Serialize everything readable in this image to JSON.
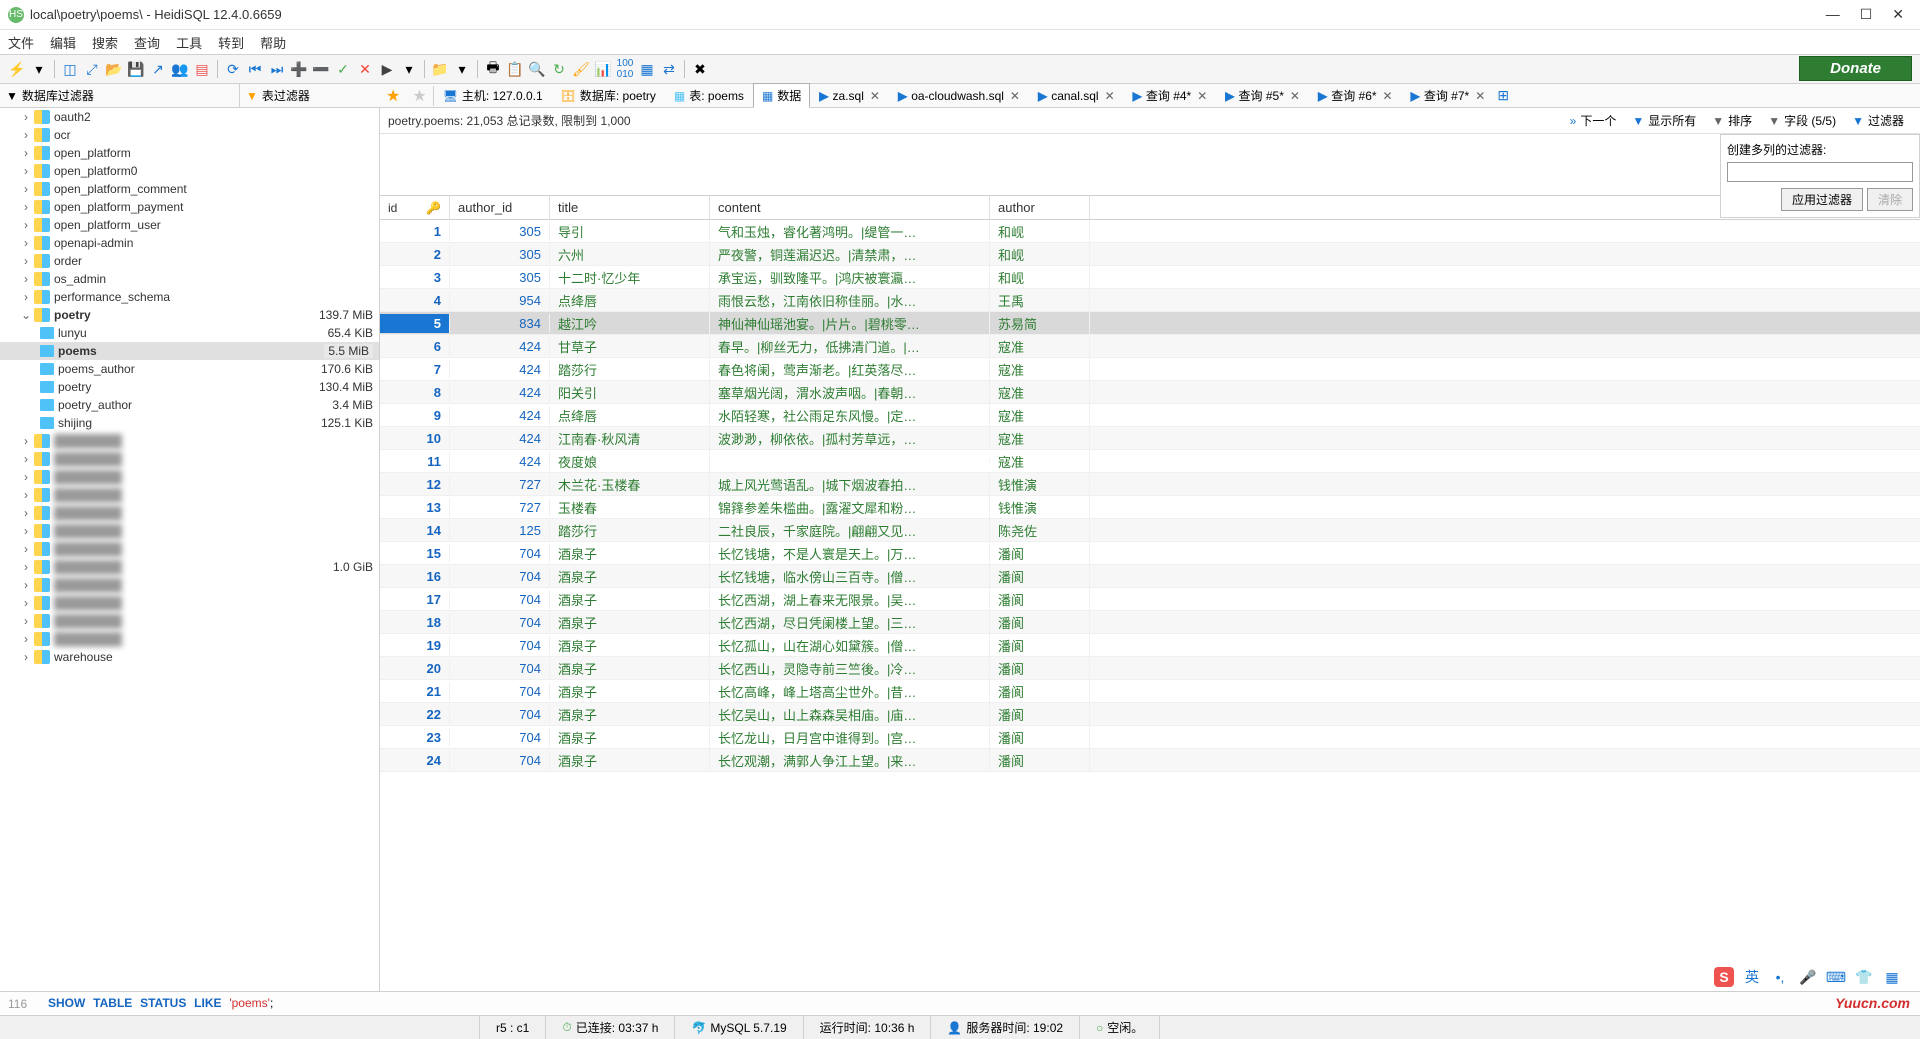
{
  "window": {
    "title": "local\\poetry\\poems\\ - HeidiSQL 12.4.0.6659"
  },
  "menu": [
    "文件",
    "编辑",
    "搜索",
    "查询",
    "工具",
    "转到",
    "帮助"
  ],
  "donate": "Donate",
  "filters": {
    "db": "数据库过滤器",
    "table": "表过滤器"
  },
  "tabs": {
    "host": "主机: 127.0.0.1",
    "database": "数据库: poetry",
    "table": "表: poems",
    "data": "数据",
    "queries": [
      {
        "label": "za.sql"
      },
      {
        "label": "oa-cloudwash.sql"
      },
      {
        "label": "canal.sql"
      },
      {
        "label": "查询 #4*"
      },
      {
        "label": "查询 #5*"
      },
      {
        "label": "查询 #6*"
      },
      {
        "label": "查询 #7*"
      }
    ]
  },
  "tree": {
    "dbs_before": [
      "oauth2",
      "ocr",
      "open_platform",
      "open_platform0",
      "open_platform_comment",
      "open_platform_payment",
      "open_platform_user",
      "openapi-admin",
      "order",
      "os_admin",
      "performance_schema"
    ],
    "poetry": {
      "name": "poetry",
      "size": "139.7 MiB",
      "tables": [
        {
          "name": "lunyu",
          "size": "65.4 KiB"
        },
        {
          "name": "poems",
          "size": "5.5 MiB",
          "selected": true
        },
        {
          "name": "poems_author",
          "size": "170.6 KiB"
        },
        {
          "name": "poetry",
          "size": "130.4 MiB"
        },
        {
          "name": "poetry_author",
          "size": "3.4 MiB"
        },
        {
          "name": "shijing",
          "size": "125.1 KiB"
        }
      ]
    },
    "gib_size": "1.0 GiB",
    "warehouse": "warehouse"
  },
  "info": {
    "summary": "poetry.poems: 21,053 总记录数, 限制到 1,000",
    "next": "下一个",
    "show_all": "显示所有",
    "sort": "排序",
    "fields": "字段 (5/5)",
    "filter": "过滤器"
  },
  "filter_panel": {
    "label": "创建多列的过滤器:",
    "apply": "应用过滤器",
    "clear": "清除"
  },
  "columns": {
    "id": "id",
    "author_id": "author_id",
    "title": "title",
    "content": "content",
    "author": "author"
  },
  "rows": [
    {
      "id": "1",
      "author_id": "305",
      "title": "导引",
      "content": "气和玉烛，睿化著鸿明。|缇管一…",
      "author": "和岘"
    },
    {
      "id": "2",
      "author_id": "305",
      "title": "六州",
      "content": "严夜警，铜莲漏迟迟。|清禁肃，…",
      "author": "和岘"
    },
    {
      "id": "3",
      "author_id": "305",
      "title": "十二时·忆少年",
      "content": "承宝运，驯致隆平。|鸿庆被寰瀛…",
      "author": "和岘"
    },
    {
      "id": "4",
      "author_id": "954",
      "title": "点绛唇",
      "content": "雨恨云愁，江南依旧称佳丽。|水…",
      "author": "王禹"
    },
    {
      "id": "5",
      "author_id": "834",
      "title": "越江吟",
      "content": "神仙神仙瑶池宴。|片片。|碧桃零…",
      "author": "苏易简",
      "selected": true
    },
    {
      "id": "6",
      "author_id": "424",
      "title": "甘草子",
      "content": "春早。|柳丝无力，低拂清门道。|…",
      "author": "寇准"
    },
    {
      "id": "7",
      "author_id": "424",
      "title": "踏莎行",
      "content": "春色将阑，莺声渐老。|红英落尽…",
      "author": "寇准"
    },
    {
      "id": "8",
      "author_id": "424",
      "title": "阳关引",
      "content": "塞草烟光阔，渭水波声咽。|春朝…",
      "author": "寇准"
    },
    {
      "id": "9",
      "author_id": "424",
      "title": "点绛唇",
      "content": "水陌轻寒，社公雨足东风慢。|定…",
      "author": "寇准"
    },
    {
      "id": "10",
      "author_id": "424",
      "title": "江南春·秋风清",
      "content": "波渺渺，柳依依。|孤村芳草远，…",
      "author": "寇准"
    },
    {
      "id": "11",
      "author_id": "424",
      "title": "夜度娘",
      "content": "",
      "author": "寇准"
    },
    {
      "id": "12",
      "author_id": "727",
      "title": "木兰花·玉楼春",
      "content": "城上风光莺语乱。|城下烟波春拍…",
      "author": "钱惟演"
    },
    {
      "id": "13",
      "author_id": "727",
      "title": "玉楼春",
      "content": "锦箨参差朱槛曲。|露濯文犀和粉…",
      "author": "钱惟演"
    },
    {
      "id": "14",
      "author_id": "125",
      "title": "踏莎行",
      "content": "二社良辰，千家庭院。|翩翩又见…",
      "author": "陈尧佐"
    },
    {
      "id": "15",
      "author_id": "704",
      "title": "酒泉子",
      "content": "长忆钱塘，不是人寰是天上。|万…",
      "author": "潘阆"
    },
    {
      "id": "16",
      "author_id": "704",
      "title": "酒泉子",
      "content": "长忆钱塘，临水傍山三百寺。|僧…",
      "author": "潘阆"
    },
    {
      "id": "17",
      "author_id": "704",
      "title": "酒泉子",
      "content": "长忆西湖，湖上春来无限景。|吴…",
      "author": "潘阆"
    },
    {
      "id": "18",
      "author_id": "704",
      "title": "酒泉子",
      "content": "长忆西湖，尽日凭阑楼上望。|三…",
      "author": "潘阆"
    },
    {
      "id": "19",
      "author_id": "704",
      "title": "酒泉子",
      "content": "长忆孤山，山在湖心如黛簇。|僧…",
      "author": "潘阆"
    },
    {
      "id": "20",
      "author_id": "704",
      "title": "酒泉子",
      "content": "长忆西山，灵隐寺前三竺後。|冷…",
      "author": "潘阆"
    },
    {
      "id": "21",
      "author_id": "704",
      "title": "酒泉子",
      "content": "长忆高峰，峰上塔高尘世外。|昔…",
      "author": "潘阆"
    },
    {
      "id": "22",
      "author_id": "704",
      "title": "酒泉子",
      "content": "长忆吴山，山上森森吴相庙。|庙…",
      "author": "潘阆"
    },
    {
      "id": "23",
      "author_id": "704",
      "title": "酒泉子",
      "content": "长忆龙山，日月宫中谁得到。|宫…",
      "author": "潘阆"
    },
    {
      "id": "24",
      "author_id": "704",
      "title": "酒泉子",
      "content": "长忆观潮，满郭人争江上望。|来…",
      "author": "潘阆"
    }
  ],
  "sql": {
    "lineno": "116",
    "kw1": "SHOW",
    "kw2": "TABLE",
    "kw3": "STATUS",
    "kw4": "LIKE",
    "str": "'poems'",
    "semicolon": ";"
  },
  "status": {
    "pos": "r5 : c1",
    "connected": "已连接: 03:37 h",
    "mysql": "MySQL 5.7.19",
    "runtime": "运行时间: 10:36 h",
    "servertime": "服务器时间: 19:02",
    "idle": "空闲。"
  },
  "ime": {
    "lang": "英"
  },
  "watermark": "Yuucn.com"
}
